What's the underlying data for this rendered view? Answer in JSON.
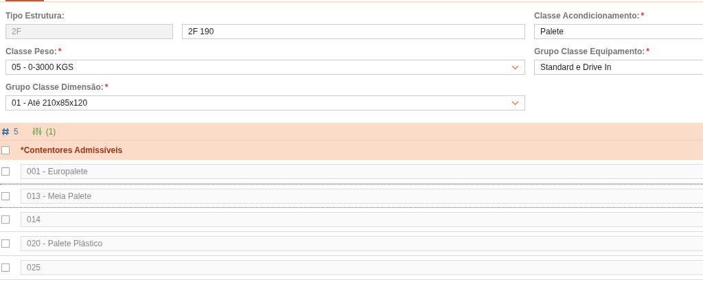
{
  "form": {
    "tipo_estrutura": {
      "label": "Tipo Estrutura:",
      "code": "2F",
      "value": "2F 190"
    },
    "classe_peso": {
      "label": "Classe Peso:",
      "required_mark": "*",
      "value": "05 - 0-3000 KGS"
    },
    "grupo_classe_dimensao": {
      "label": "Grupo Classe Dimensão:",
      "required_mark": "*",
      "value": "01 - Até 210x85x120"
    },
    "classe_acondicionamento": {
      "label": "Classe Acondicionamento:",
      "required_mark": "*",
      "value": "Palete"
    },
    "grupo_classe_equipamento": {
      "label": "Grupo Classe Equipamento:",
      "required_mark": "*",
      "value": "Standard e Drive In"
    }
  },
  "grid": {
    "count": "5",
    "filter_count": "(1)",
    "header": {
      "label": "*Contentores Admissíveis",
      "checked": false
    },
    "rows": [
      {
        "value": "001 - Europalete",
        "checked": false,
        "selected": false
      },
      {
        "value": "013 - Meia Palete",
        "checked": false,
        "selected": true
      },
      {
        "value": "014",
        "checked": false,
        "selected": false
      },
      {
        "value": "020 - Palete Plástico",
        "checked": false,
        "selected": false
      },
      {
        "value": "025",
        "checked": false,
        "selected": false
      }
    ]
  }
}
